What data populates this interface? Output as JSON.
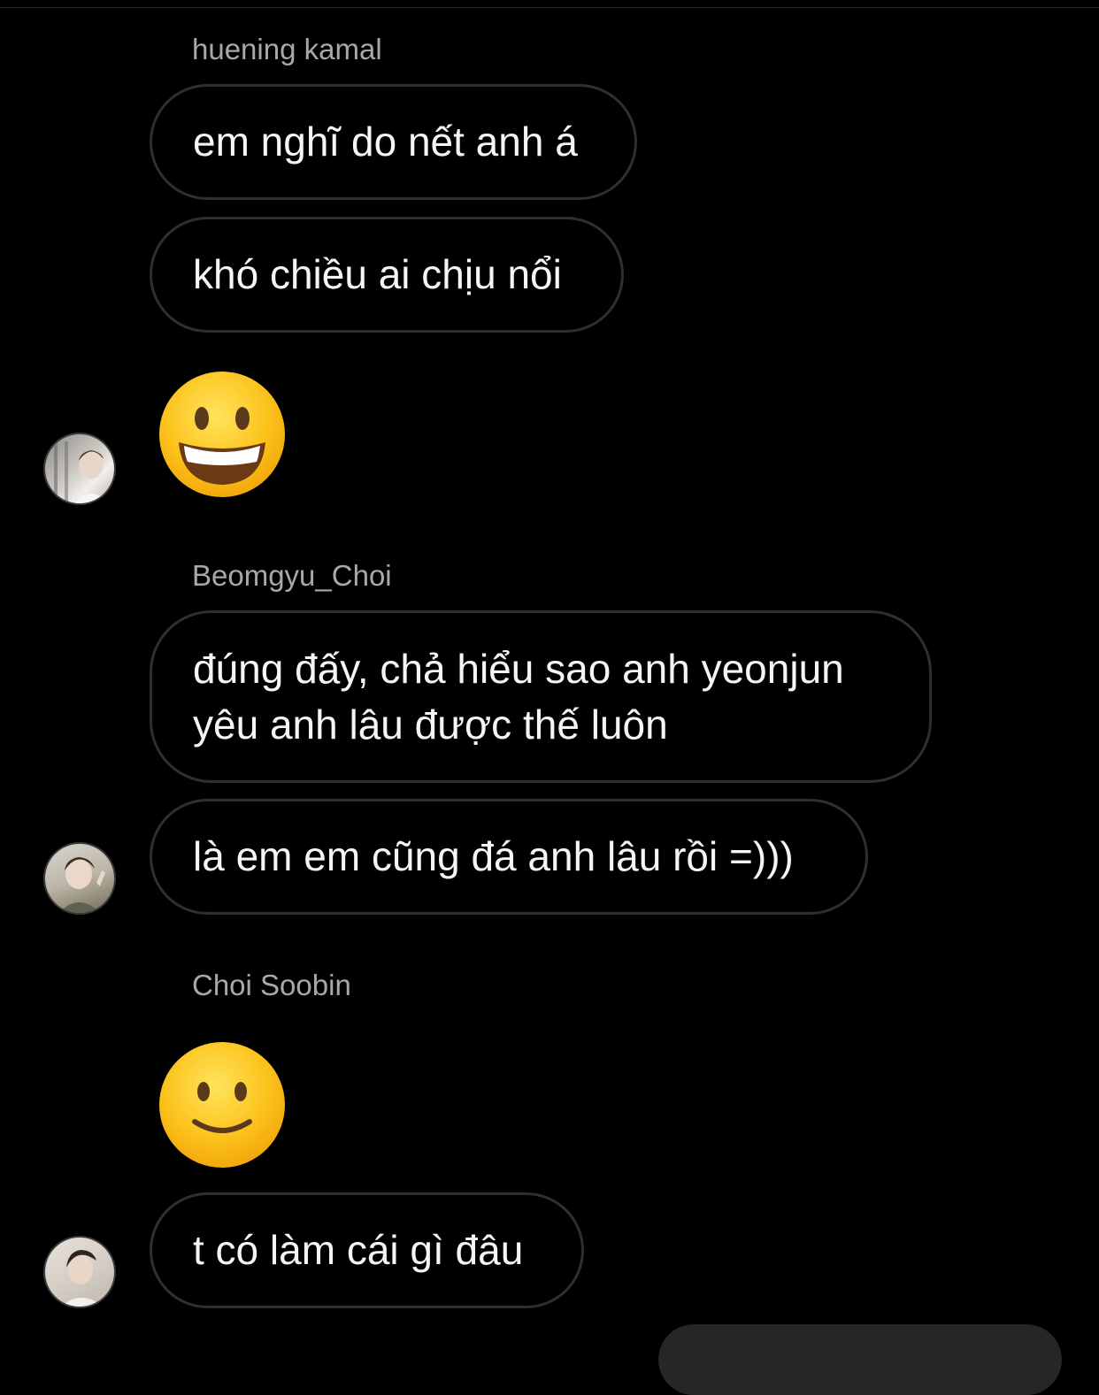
{
  "colors": {
    "background": "#000000",
    "sender_text": "#a8a8a8",
    "bubble_border": "#2f2f2f",
    "message_text": "#f5f5f5"
  },
  "groups": [
    {
      "sender": "huening kamal",
      "messages": [
        "em nghĩ do nết anh á",
        "khó chiều ai chịu nổi"
      ],
      "reaction_icon": "grinning-face-emoji"
    },
    {
      "sender": "Beomgyu_Choi",
      "messages": [
        "đúng đấy, chả hiểu sao anh yeonjun yêu anh lâu được thế luôn",
        "là em em cũng đá anh lâu rồi =)))"
      ]
    },
    {
      "sender": "Choi Soobin",
      "reaction_icon": "slightly-smiling-face-emoji",
      "messages": [
        "t có làm cái gì đâu"
      ]
    }
  ]
}
